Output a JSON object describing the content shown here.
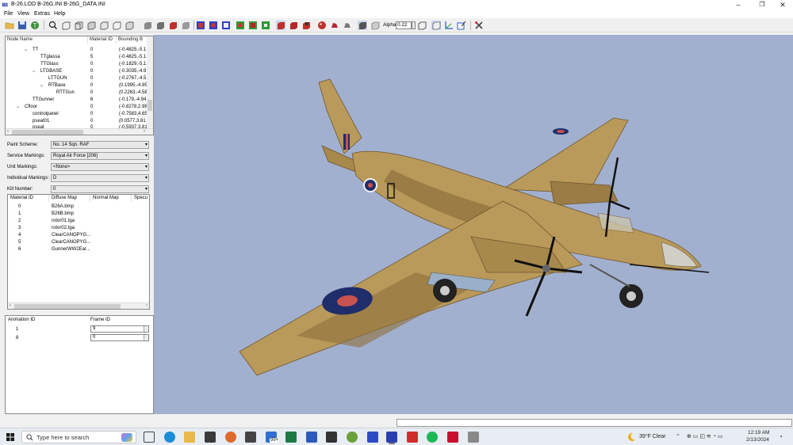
{
  "window": {
    "title": "B-26.LOD  B-26G.INI  B-26G_DATA.INI",
    "minimize": "–",
    "maximize": "❐",
    "close": "✕"
  },
  "menu": [
    "File",
    "View",
    "Extras",
    "Help"
  ],
  "toolbar": {
    "alpha_label": "Alpha:",
    "alpha_value": "0.22"
  },
  "tree": {
    "headers": [
      "Node Name",
      "Material ID",
      "Bounding B"
    ],
    "rows": [
      {
        "name": "TT",
        "mat": "0",
        "bb": "(-0.4825,-5.1"
      },
      {
        "name": "TTglassa",
        "mat": "5",
        "bb": "(-0.4825,-5.1"
      },
      {
        "name": "TTGlass",
        "mat": "0",
        "bb": "(-0.1829,-5.1"
      },
      {
        "name": "LTGBASE",
        "mat": "0",
        "bb": "(-0.3035,-4.9"
      },
      {
        "name": "LTTGUN",
        "mat": "0",
        "bb": "(-0.2767,-4.5"
      },
      {
        "name": "RTBase",
        "mat": "0",
        "bb": "(0.1995,-4.95"
      },
      {
        "name": "RTTGun",
        "mat": "0",
        "bb": "(0.2263,-4.58"
      },
      {
        "name": "TTGunner",
        "mat": "6",
        "bb": "(-0.179,-4.94"
      },
      {
        "name": "Cfloor",
        "mat": "0",
        "bb": "(-0.8278,2.98"
      },
      {
        "name": "controlpanel",
        "mat": "0",
        "bb": "(-0.7583,4.65"
      },
      {
        "name": "pseat01",
        "mat": "0",
        "bb": "(0.0577,3.81"
      },
      {
        "name": "pseat",
        "mat": "0",
        "bb": "(-0.5937,3.81"
      }
    ]
  },
  "properties": [
    {
      "label": "Paint Scheme:",
      "value": "No. 14 Sqn. RAF"
    },
    {
      "label": "Service Markings:",
      "value": "Royal Air Force [206]"
    },
    {
      "label": "Unit Markings:",
      "value": "<None>"
    },
    {
      "label": "Individual Markings:",
      "value": "D"
    },
    {
      "label": "Kill Number:",
      "value": "0"
    }
  ],
  "materials": {
    "headers": [
      "Material ID",
      "Diffuse Map",
      "Normal Map",
      "Specu"
    ],
    "rows": [
      {
        "id": "0",
        "diffuse": "B26A.bmp"
      },
      {
        "id": "1",
        "diffuse": "B26B.bmp"
      },
      {
        "id": "2",
        "diffuse": "rotor01.tga"
      },
      {
        "id": "3",
        "diffuse": "rotor02.tga"
      },
      {
        "id": "4",
        "diffuse": "ClearCANOPYG..."
      },
      {
        "id": "5",
        "diffuse": "ClearCANOPYG..."
      },
      {
        "id": "6",
        "diffuse": "GunnerWW2Ear..."
      }
    ]
  },
  "animation": {
    "headers": [
      "Animation ID",
      "Frame ID"
    ],
    "rows": [
      {
        "id": "1",
        "frame": "9"
      },
      {
        "id": "8",
        "frame": "0"
      }
    ]
  },
  "taskbar": {
    "search_placeholder": "Type here to search",
    "weather": "39°F  Clear",
    "time": "12:19 AM",
    "date": "2/13/2024",
    "badge": "99+"
  },
  "colors": {
    "viewport_bg": "#a2b0cf",
    "camo_tan": "#b99a5a",
    "camo_dark": "#8d6f3b",
    "roundel_blue": "#1f2d6b",
    "roundel_red": "#c8524f"
  }
}
